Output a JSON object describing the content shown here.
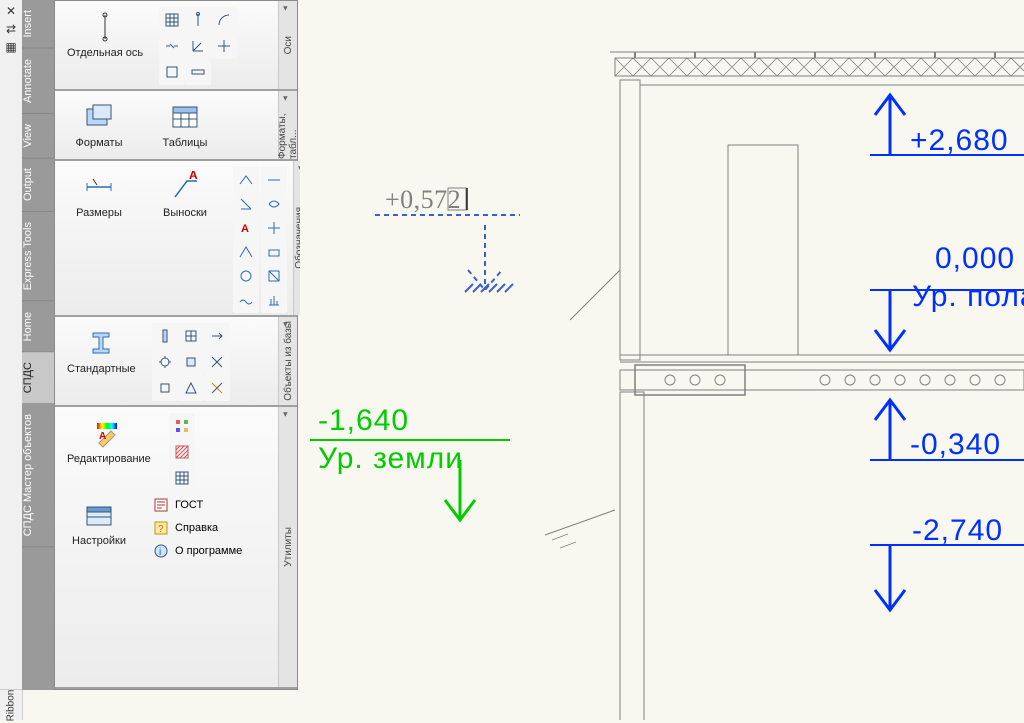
{
  "ribbon_title": "Ribbon",
  "tabs": [
    {
      "id": "insert",
      "label": "Insert"
    },
    {
      "id": "annotate",
      "label": "Annotate"
    },
    {
      "id": "view",
      "label": "View"
    },
    {
      "id": "output",
      "label": "Output"
    },
    {
      "id": "express",
      "label": "Express Tools"
    },
    {
      "id": "home",
      "label": "Home"
    },
    {
      "id": "spds",
      "label": "СПДС"
    },
    {
      "id": "spdsmaster",
      "label": "СПДС Мастер объектов"
    }
  ],
  "panels": {
    "axes": {
      "big": "Отдельная ось",
      "side": "Оси"
    },
    "formats": {
      "big1": "Форматы",
      "big2": "Таблицы",
      "side": "Форматы, табл..."
    },
    "dims": {
      "big1": "Размеры",
      "big2": "Выноски",
      "side": "Обозначения"
    },
    "db": {
      "big": "Стандартные",
      "side": "Объекты из базы"
    },
    "util": {
      "big1": "Редактирование",
      "big2": "Настройки",
      "row1": "ГОСТ",
      "row2": "Справка",
      "row3": "О программе",
      "side": "Утилиты"
    }
  },
  "drawing": {
    "elev1": "+2,680",
    "elev2a": "0,000",
    "elev2b": "Ур. пола",
    "elev3": "-0,340",
    "elev4": "-2,740",
    "ground_val": "-1,640",
    "ground_lbl": "Ур. земли",
    "input_val": "+0,572"
  }
}
